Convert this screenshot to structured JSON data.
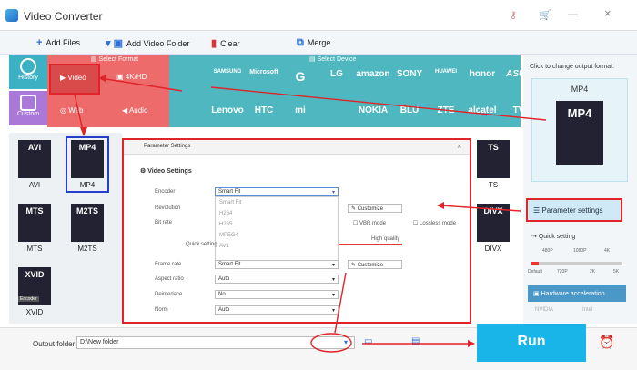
{
  "app": {
    "title": "Video Converter"
  },
  "toolbar": {
    "add_files": "Add Files",
    "add_video_folder": "Add Video Folder",
    "clear": "Clear",
    "merge": "Merge"
  },
  "sidebar": {
    "history": "History",
    "custom": "Custom"
  },
  "format_panel": {
    "header": "Select Format",
    "video": "Video",
    "hd": "4K/HD",
    "web": "Web",
    "audio": "Audio"
  },
  "device_panel": {
    "header": "Select Device",
    "row1": [
      "",
      "SAMSUNG",
      "Microsoft",
      "G",
      "LG",
      "amazon",
      "SONY",
      "HUAWEI",
      "honor",
      "ASUS"
    ],
    "row2": [
      "",
      "Lenovo",
      "HTC",
      "mi",
      "",
      "NOKIA",
      "BLU",
      "ZTE",
      "alcatel",
      "TV"
    ]
  },
  "formats": [
    "AVI",
    "MP4",
    "MTS",
    "M2TS",
    "XVID"
  ],
  "formats_right": [
    "TS",
    "DIVX"
  ],
  "encoder_badge": "Encoder",
  "right": {
    "caption": "Click to change output format:",
    "format": "MP4",
    "format_doc": "MP4",
    "param_settings": "Parameter settings",
    "quick_setting": "Quick setting",
    "res_top": [
      "480P",
      "1080P",
      "4K"
    ],
    "res_bottom": [
      "Default",
      "720P",
      "2K",
      "5K"
    ],
    "hw_accel": "Hardware acceleration",
    "nvidia": "NVIDIA",
    "intel": "Intel"
  },
  "dialog": {
    "title": "Parameter Settings",
    "section": "Video Settings",
    "encoder_label": "Encoder",
    "encoder_value": "Smart Fit",
    "encoder_options": [
      "Smart Fit",
      "H264",
      "H265",
      "MPEG4",
      "AV1"
    ],
    "resolution_label": "Revolution",
    "bitrate_label": "Bit rate",
    "customize": "Customize",
    "vbr": "VBR mode",
    "lossless": "Lossless mode",
    "quick_setting": "Quick setting",
    "high_quality": "High quality",
    "framerate_label": "Frame rate",
    "framerate_value": "Smart Fit",
    "aspect_label": "Aspect ratio",
    "aspect_value": "Auto",
    "deinterlace_label": "Deinterlace",
    "deinterlace_value": "No",
    "norm_label": "Norm",
    "norm_value": "Auto",
    "close": "×"
  },
  "bottom": {
    "output_label": "Output folder:",
    "output_value": "D:\\New folder",
    "run": "Run"
  },
  "colors": {
    "accent_red": "#e0242a",
    "format_red": "#ee6b6b",
    "device_teal": "#4fb7c0",
    "run_blue": "#19b5e8"
  }
}
